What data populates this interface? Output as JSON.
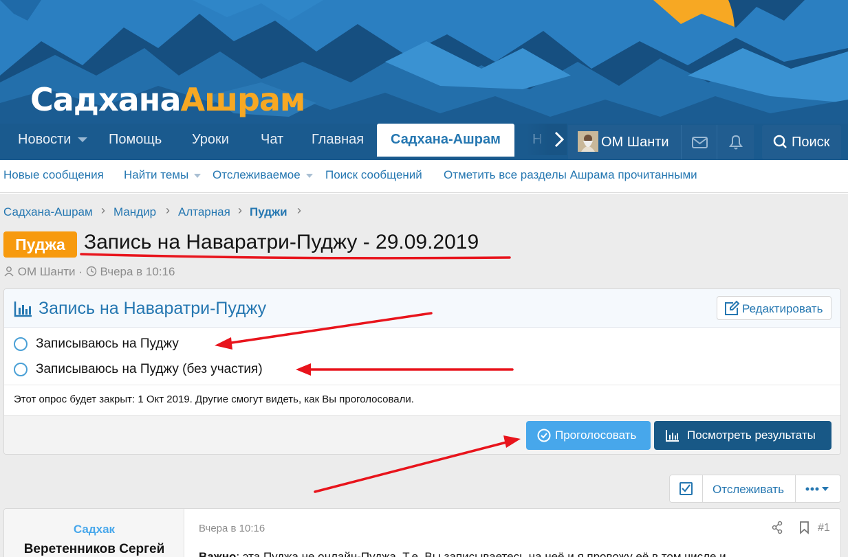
{
  "logo": {
    "part1": "Садхана",
    "part2": "Ашрам"
  },
  "nav": {
    "tabs": [
      {
        "label": "Новости",
        "has_menu": true
      },
      {
        "label": "Помощь"
      },
      {
        "label": "Уроки"
      },
      {
        "label": "Чат"
      },
      {
        "label": "Главная"
      },
      {
        "label": "Садхана-Ашрам",
        "active": true
      },
      {
        "label": "Н"
      }
    ],
    "user": "ОМ Шанти",
    "search": "Поиск"
  },
  "subnav": {
    "items": [
      {
        "label": "Новые сообщения"
      },
      {
        "label": "Найти темы",
        "has_menu": true
      },
      {
        "label": "Отслеживаемое",
        "has_menu": true
      },
      {
        "label": "Поиск сообщений"
      },
      {
        "label": "Отметить все разделы Ашрама прочитанными"
      }
    ]
  },
  "breadcrumb": [
    "Садхана-Ашрам",
    "Мандир",
    "Алтарная",
    "Пуджи"
  ],
  "thread": {
    "prefix": "Пуджа",
    "title": "Запись на Наваратри-Пуджу - 29.09.2019",
    "author": "ОМ Шанти",
    "date": "Вчера в 10:16"
  },
  "poll": {
    "title": "Запись на Наваратри-Пуджу",
    "edit_label": "Редактировать",
    "options": [
      "Записываюсь на Пуджу",
      "Записываюсь на Пуджу (без участия)"
    ],
    "note": "Этот опрос будет закрыт: 1 Окт 2019. Другие смогут видеть, как Вы проголосовали.",
    "vote_label": "Проголосовать",
    "results_label": "Посмотреть результаты"
  },
  "actions": {
    "watch_label": "Отслеживать"
  },
  "post": {
    "user_title": "Садхак",
    "user_name": "Веретенников Сергей",
    "date": "Вчера в 10:16",
    "number": "#1",
    "text_bold": "Важно",
    "text": ": эта Пуджа не онлайн-Пуджа. Т.е. Вы записываетесь на неё и я провожу её в том числе и"
  },
  "colors": {
    "accent": "#2577b1",
    "header": "#1a5f94",
    "prefix": "#f79a0e",
    "vote": "#47a7eb",
    "results": "#185886",
    "annotation": "#e8141c"
  }
}
